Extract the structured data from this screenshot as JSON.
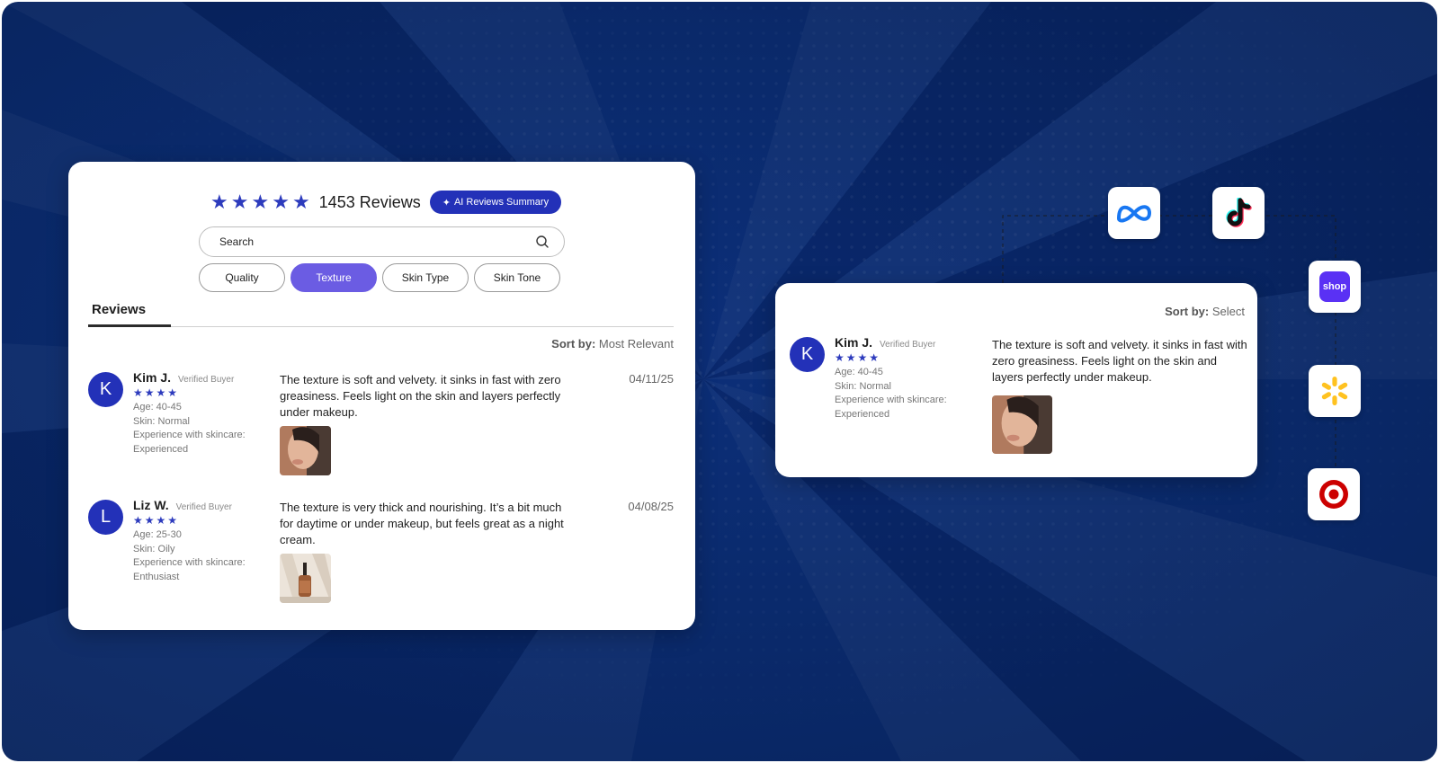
{
  "header": {
    "rating_stars": 5,
    "reviews_count": "1453 Reviews",
    "ai_summary_label": "AI Reviews Summary"
  },
  "search": {
    "placeholder": "Search"
  },
  "filters": [
    {
      "label": "Quality",
      "active": false
    },
    {
      "label": "Texture",
      "active": true
    },
    {
      "label": "Skin Type",
      "active": false
    },
    {
      "label": "Skin Tone",
      "active": false
    }
  ],
  "tabs": {
    "reviews_label": "Reviews"
  },
  "sort": {
    "label": "Sort by:",
    "value": "Most Relevant"
  },
  "reviews": [
    {
      "initial": "K",
      "name": "Kim J.",
      "badge": "Verified Buyer",
      "stars": 4,
      "age": "Age: 40-45",
      "skin": "Skin: Normal",
      "experience": "Experience with skincare: Experienced",
      "text": "The texture is soft and velvety. it sinks in fast with zero greasiness. Feels light on the skin and layers perfectly under makeup.",
      "date": "04/11/25"
    },
    {
      "initial": "L",
      "name": "Liz W.",
      "badge": "Verified Buyer",
      "stars": 4,
      "age": "Age: 25-30",
      "skin": "Skin: Oily",
      "experience": "Experience with skincare: Enthusiast",
      "text": "The texture is very thick and nourishing. It’s a bit much for daytime or under makeup, but feels great as a night cream.",
      "date": "04/08/25"
    }
  ],
  "side_card": {
    "sort_label": "Sort by:",
    "sort_value": "Select",
    "review": {
      "initial": "K",
      "name": "Kim J.",
      "badge": "Verified Buyer",
      "stars": 4,
      "age": "Age: 40-45",
      "skin": "Skin: Normal",
      "experience": "Experience with skincare: Experienced",
      "text": "The texture is soft and velvety. it sinks in fast with zero greasiness. Feels light on the skin and layers perfectly under makeup."
    }
  },
  "integrations": [
    {
      "icon": "meta-logo-icon"
    },
    {
      "icon": "tiktok-logo-icon"
    },
    {
      "icon": "shop-logo-icon",
      "text": "shop"
    },
    {
      "icon": "walmart-logo-icon"
    },
    {
      "icon": "target-logo-icon"
    }
  ],
  "colors": {
    "background": "#0a2a6c",
    "accent": "#2331b8",
    "active_chip": "#6b5ce3",
    "shop": "#5a31f4",
    "walmart": "#ffc220",
    "target": "#cc0000"
  }
}
